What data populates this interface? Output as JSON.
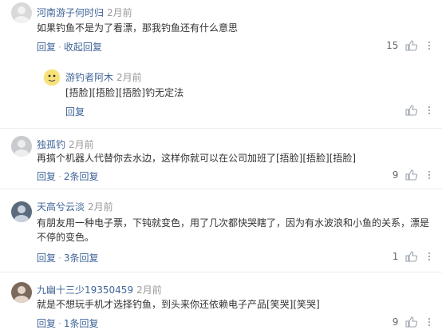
{
  "comments": [
    {
      "username": "河南游子何时归",
      "time": "2月前",
      "text": "如果钓鱼不是为了看漂，那我钓鱼还有什么意思",
      "reply_label": "回复",
      "collapse_label": "收起回复",
      "likes": "15",
      "replies": [
        {
          "username": "游钓者阿木",
          "time": "2月前",
          "text": "[捂脸][捂脸][捂脸]钓无定法",
          "reply_label": "回复"
        }
      ]
    },
    {
      "username": "独孤钓",
      "time": "2月前",
      "text": "再搞个机器人代替你去水边，这样你就可以在公司加班了[捂脸][捂脸][捂脸]",
      "reply_label": "回复",
      "reply_count_label": "2条回复",
      "likes": "9"
    },
    {
      "username": "天高兮云淡",
      "time": "2月前",
      "text": "有朋友用一种电子票，下钝就变色，用了几次都快哭瞎了，因为有水波浪和小鱼的关系，漂是不停的变色。",
      "reply_label": "回复",
      "reply_count_label": "3条回复",
      "likes": "1"
    },
    {
      "username": "九幽十三少19350459",
      "time": "2月前",
      "text": "就是不想玩手机才选择钓鱼，到头来你还依赖电子产品[笑哭][笑哭]",
      "reply_label": "回复",
      "reply_count_label": "1条回复",
      "likes": "9"
    }
  ],
  "colors": {
    "link": "#406599",
    "time": "#999999",
    "text": "#333333"
  },
  "icons": {
    "like": "thumbs-up-icon",
    "more": "more-dots-icon"
  }
}
